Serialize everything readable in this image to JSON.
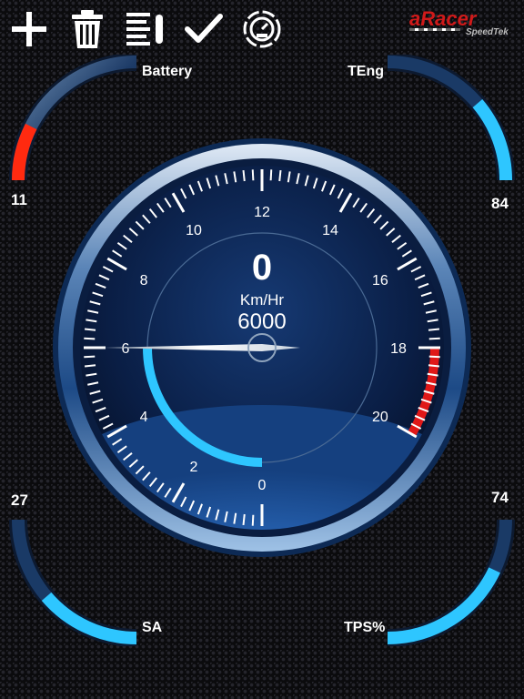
{
  "toolbar": {
    "add_icon": "plus-icon",
    "delete_icon": "trash-icon",
    "list_icon": "list-icon",
    "confirm_icon": "checkmark-icon",
    "gauge_icon": "gauge-settings-icon"
  },
  "brand": {
    "logo": "aRacer",
    "subtitle": "SpeedTek",
    "logo_color": "#d01a1a"
  },
  "gauges": {
    "battery": {
      "label": "Battery",
      "value": "11",
      "level": 0.3,
      "color": "#ff2a10"
    },
    "teng": {
      "label": "TEng",
      "value": "84",
      "level": 0.45,
      "color": "#2ec6ff"
    },
    "sa": {
      "label": "SA",
      "value": "27",
      "level": 0.55,
      "color": "#2ec6ff"
    },
    "tps": {
      "label": "TPS%",
      "value": "74",
      "level": 0.72,
      "color": "#2ec6ff"
    }
  },
  "speedometer": {
    "speed": "0",
    "unit": "Km/Hr",
    "rpm": "6000",
    "scale_labels": [
      "0",
      "2",
      "4",
      "6",
      "8",
      "10",
      "12",
      "14",
      "16",
      "18",
      "20"
    ],
    "redline_start": 18,
    "needle_value": 6,
    "accent_color": "#2ec6ff",
    "redline_color": "#e01818"
  }
}
